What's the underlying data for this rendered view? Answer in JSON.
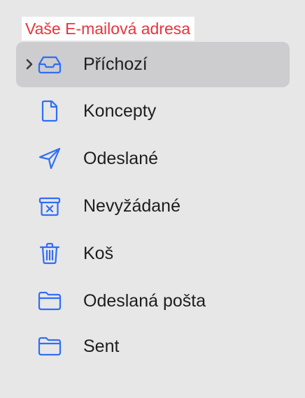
{
  "account": {
    "label": "Vaše E-mailová adresa"
  },
  "colors": {
    "accent": "#2f6ef5",
    "account_label": "#e8343b",
    "selected_background": "#cdcccf",
    "sidebar_background": "#e8e7e8"
  },
  "mailboxes": [
    {
      "label": "Příchozí",
      "icon": "inbox-tray-icon",
      "selected": true,
      "expandable": true
    },
    {
      "label": "Koncepty",
      "icon": "document-icon",
      "selected": false
    },
    {
      "label": "Odeslané",
      "icon": "paper-plane-icon",
      "selected": false
    },
    {
      "label": "Nevyžádané",
      "icon": "junk-box-icon",
      "selected": false
    },
    {
      "label": "Koš",
      "icon": "trash-icon",
      "selected": false
    },
    {
      "label": "Odeslaná pošta",
      "icon": "folder-icon",
      "selected": false
    },
    {
      "label": "Sent",
      "icon": "folder-icon",
      "selected": false
    }
  ]
}
